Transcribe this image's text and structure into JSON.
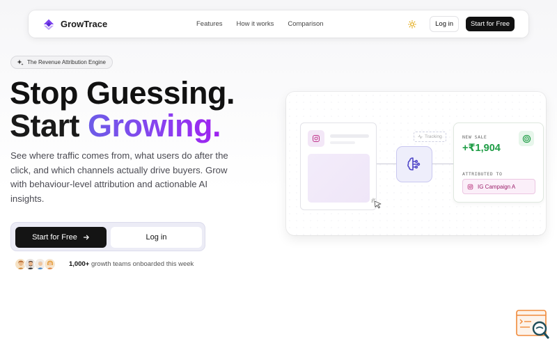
{
  "nav": {
    "brand": "GrowTrace",
    "links": [
      "Features",
      "How it works",
      "Comparison"
    ],
    "login_label": "Log in",
    "start_label": "Start for Free"
  },
  "hero": {
    "badge": "The Revenue Attribution Engine",
    "title_line1": "Stop Guessing.",
    "title_line2_a": "Start",
    "title_line2_b": "Growing.",
    "description": "See where traffic comes from, what users do after the click, and which channels actually drive buyers. Grow with behaviour-level attribution and actionable AI insights.",
    "cta_primary": "Start for Free",
    "cta_secondary": "Log in",
    "social_count": "1,000+",
    "social_text": " growth teams onboarded this week"
  },
  "visual": {
    "tracking_label": "Tracking",
    "sale_label": "NEW SALE",
    "sale_amount": "+₹1,904",
    "attributed_label": "ATTRIBUTED TO",
    "campaign": "IG Campaign A"
  },
  "colors": {
    "accent_purple": "#7b3ff0",
    "success_green": "#1f9d46",
    "dark": "#141414"
  },
  "icons": [
    "logo-icon",
    "sun-icon",
    "sparkle-icon",
    "arrow-right-icon",
    "instagram-icon",
    "hub-icon",
    "cursor-icon",
    "target-icon",
    "search-widget-icon"
  ]
}
